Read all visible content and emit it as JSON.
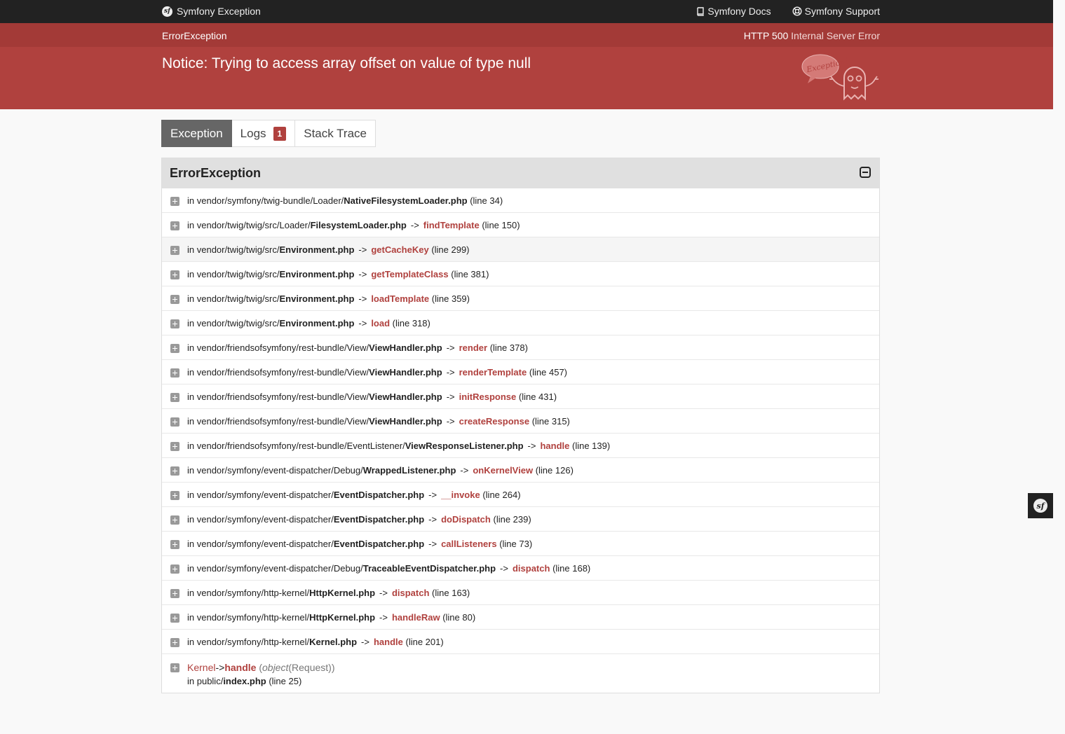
{
  "topbar": {
    "brand": "Symfony Exception",
    "docs_label": "Symfony Docs",
    "support_label": "Symfony Support"
  },
  "header": {
    "exception_class": "ErrorException",
    "status_code": "HTTP 500",
    "status_text": "Internal Server Error",
    "message": "Notice: Trying to access array offset on value of type null",
    "ghost_bubble": "Exception!"
  },
  "tabs": [
    {
      "label": "Exception",
      "active": true
    },
    {
      "label": "Logs",
      "badge": "1"
    },
    {
      "label": "Stack Trace"
    }
  ],
  "panel": {
    "title": "ErrorException"
  },
  "trace": [
    {
      "path": "in vendor/symfony/twig-bundle/Loader/",
      "file": "NativeFilesystemLoader.php",
      "fn": "",
      "line": "(line 34)"
    },
    {
      "path": "in vendor/twig/twig/src/Loader/",
      "file": "FilesystemLoader.php",
      "fn": "findTemplate",
      "line": "(line 150)"
    },
    {
      "path": "in vendor/twig/twig/src/",
      "file": "Environment.php",
      "fn": "getCacheKey",
      "line": "(line 299)",
      "highlight": true
    },
    {
      "path": "in vendor/twig/twig/src/",
      "file": "Environment.php",
      "fn": "getTemplateClass",
      "line": "(line 381)"
    },
    {
      "path": "in vendor/twig/twig/src/",
      "file": "Environment.php",
      "fn": "loadTemplate",
      "line": "(line 359)"
    },
    {
      "path": "in vendor/twig/twig/src/",
      "file": "Environment.php",
      "fn": "load",
      "line": "(line 318)"
    },
    {
      "path": "in vendor/friendsofsymfony/rest-bundle/View/",
      "file": "ViewHandler.php",
      "fn": "render",
      "line": "(line 378)"
    },
    {
      "path": "in vendor/friendsofsymfony/rest-bundle/View/",
      "file": "ViewHandler.php",
      "fn": "renderTemplate",
      "line": "(line 457)"
    },
    {
      "path": "in vendor/friendsofsymfony/rest-bundle/View/",
      "file": "ViewHandler.php",
      "fn": "initResponse",
      "line": "(line 431)"
    },
    {
      "path": "in vendor/friendsofsymfony/rest-bundle/View/",
      "file": "ViewHandler.php",
      "fn": "createResponse",
      "line": "(line 315)"
    },
    {
      "path": "in vendor/friendsofsymfony/rest-bundle/EventListener/",
      "file": "ViewResponseListener.php",
      "fn": "handle",
      "line": "(line 139)"
    },
    {
      "path": "in vendor/symfony/event-dispatcher/Debug/",
      "file": "WrappedListener.php",
      "fn": "onKernelView",
      "line": "(line 126)"
    },
    {
      "path": "in vendor/symfony/event-dispatcher/",
      "file": "EventDispatcher.php",
      "fn": "__invoke",
      "line": "(line 264)"
    },
    {
      "path": "in vendor/symfony/event-dispatcher/",
      "file": "EventDispatcher.php",
      "fn": "doDispatch",
      "line": "(line 239)"
    },
    {
      "path": "in vendor/symfony/event-dispatcher/",
      "file": "EventDispatcher.php",
      "fn": "callListeners",
      "line": "(line 73)"
    },
    {
      "path": "in vendor/symfony/event-dispatcher/Debug/",
      "file": "TraceableEventDispatcher.php",
      "fn": "dispatch",
      "line": "(line 168)"
    },
    {
      "path": "in vendor/symfony/http-kernel/",
      "file": "HttpKernel.php",
      "fn": "dispatch",
      "line": "(line 163)"
    },
    {
      "path": "in vendor/symfony/http-kernel/",
      "file": "HttpKernel.php",
      "fn": "handleRaw",
      "line": "(line 80)"
    },
    {
      "path": "in vendor/symfony/http-kernel/",
      "file": "Kernel.php",
      "fn": "handle",
      "line": "(line 201)"
    }
  ],
  "trace_last": {
    "class": "Kernel",
    "arrow": "->",
    "fn": "handle",
    "args_open": "(",
    "args_type": "object",
    "args_value": "(Request))",
    "path": "in public/",
    "file": "index.php",
    "line": "(line 25)"
  },
  "arrow": "->",
  "sf_mark": "sf"
}
